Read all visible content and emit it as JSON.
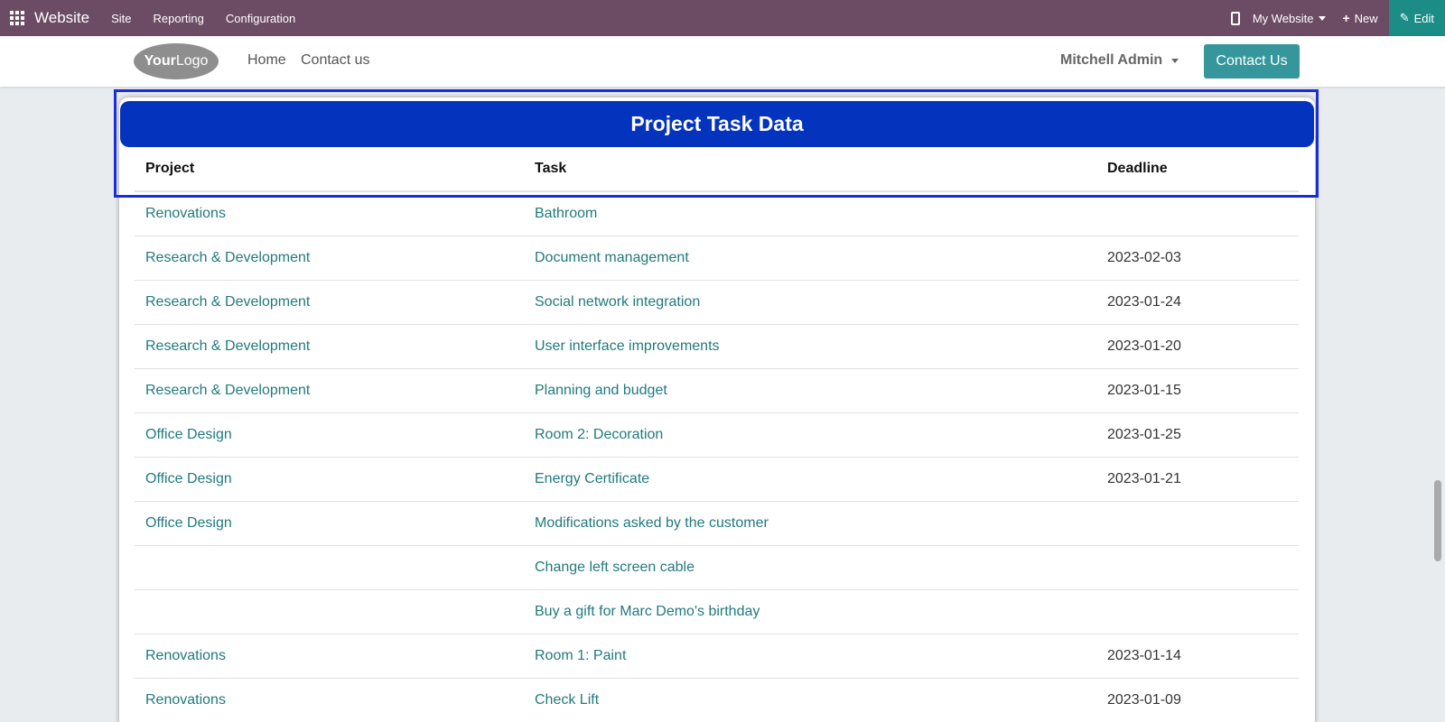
{
  "admin_bar": {
    "app_name": "Website",
    "menu": [
      "Site",
      "Reporting",
      "Configuration"
    ],
    "website_selector": "My Website",
    "new_label": "New",
    "edit_label": "Edit"
  },
  "header": {
    "logo_text_bold": "Your",
    "logo_text": "Logo",
    "nav": [
      "Home",
      "Contact us"
    ],
    "user_name": "Mitchell Admin",
    "contact_button": "Contact Us"
  },
  "card": {
    "title": "Project Task Data",
    "columns": [
      "Project",
      "Task",
      "Deadline"
    ],
    "rows": [
      {
        "project": "Renovations",
        "task": "Bathroom",
        "deadline": ""
      },
      {
        "project": "Research & Development",
        "task": "Document management",
        "deadline": "2023-02-03"
      },
      {
        "project": "Research & Development",
        "task": "Social network integration",
        "deadline": "2023-01-24"
      },
      {
        "project": "Research & Development",
        "task": "User interface improvements",
        "deadline": "2023-01-20"
      },
      {
        "project": "Research & Development",
        "task": "Planning and budget",
        "deadline": "2023-01-15"
      },
      {
        "project": "Office Design",
        "task": "Room 2: Decoration",
        "deadline": "2023-01-25"
      },
      {
        "project": "Office Design",
        "task": "Energy Certificate",
        "deadline": "2023-01-21"
      },
      {
        "project": "Office Design",
        "task": "Modifications asked by the customer",
        "deadline": ""
      },
      {
        "project": "",
        "task": "Change left screen cable",
        "deadline": ""
      },
      {
        "project": "",
        "task": "Buy a gift for Marc Demo's birthday",
        "deadline": ""
      },
      {
        "project": "Renovations",
        "task": "Room 1: Paint",
        "deadline": "2023-01-14"
      },
      {
        "project": "Renovations",
        "task": "Check Lift",
        "deadline": "2023-01-09"
      }
    ]
  },
  "colors": {
    "admin_bar": "#6b4c64",
    "edit_button": "#1b8c86",
    "title_band": "#0433bd",
    "link": "#217a7d",
    "contact_button": "#35979c",
    "highlight": "#1a2ddb"
  }
}
